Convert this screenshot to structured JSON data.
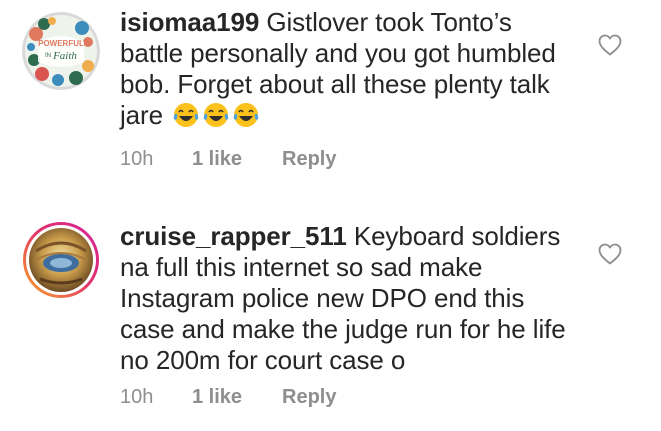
{
  "comments": [
    {
      "username": "isiomaa199",
      "text": "Gistlover took Tonto’s battle personally and you got humbled bob. Forget about all these plenty talk jare",
      "emoji": [
        "face-with-tears-of-joy",
        "face-with-tears-of-joy",
        "face-with-tears-of-joy"
      ],
      "avatar_text": [
        "POWERFUL",
        "IN",
        "Faith"
      ],
      "time": "10h",
      "likes": "1 like",
      "reply": "Reply"
    },
    {
      "username": "cruise_rapper_511",
      "text": "Keyboard soldiers na full this internet so sad make Instagram police new DPO end this case and make the judge run for he life no 200m for court case o",
      "time": "10h",
      "likes": "1 like",
      "reply": "Reply"
    }
  ],
  "colors": {
    "text": "#262626",
    "meta": "#8e8e8e",
    "story_ring_start": "#f9a825",
    "story_ring_end": "#d6249f"
  }
}
